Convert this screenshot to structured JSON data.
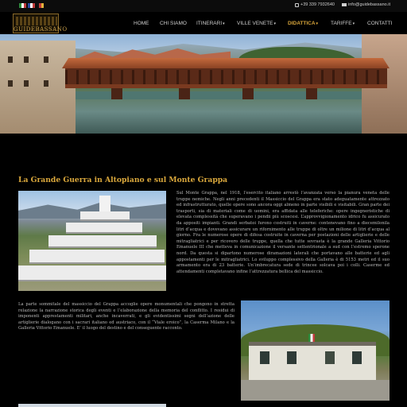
{
  "topbar": {
    "languages": [
      {
        "code": "it",
        "colors": [
          "#2a8a3a",
          "#ffffff",
          "#c23b3b"
        ]
      },
      {
        "code": "fr",
        "colors": [
          "#2b4aa0",
          "#ffffff",
          "#c23b3b"
        ]
      },
      {
        "code": "de",
        "colors": [
          "#111111",
          "#c23b3b",
          "#e2b23a"
        ]
      }
    ],
    "phone": "+39 339 7932640",
    "email": "info@guidebassano.it"
  },
  "header": {
    "logo_text": "GUIDEBASSANO",
    "nav": [
      {
        "label": "HOME",
        "has_dropdown": false,
        "active": false
      },
      {
        "label": "CHI SIAMO",
        "has_dropdown": false,
        "active": false
      },
      {
        "label": "ITINERARI",
        "has_dropdown": true,
        "active": false
      },
      {
        "label": "VILLE VENETE",
        "has_dropdown": true,
        "active": false
      },
      {
        "label": "DIDATTICA",
        "has_dropdown": true,
        "active": true
      },
      {
        "label": "TARIFFE",
        "has_dropdown": true,
        "active": false
      },
      {
        "label": "CONTATTI",
        "has_dropdown": false,
        "active": false
      }
    ],
    "chevron": "▾"
  },
  "colors": {
    "accent": "#d6a43a",
    "background": "#000000"
  },
  "content": {
    "title": "La Grande Guerra in Altopiano e sul Monte Grappa",
    "paragraph_1": "Sul Monte Grappa, nel 1918, l’esercito italiano arrestò l’avanzata verso la pianura veneta delle truppe nemiche. Negli anni precedenti il Massiccio del Grappa era stato adeguatamente attrezzato ed infrastrutturato, quelle opere sono ancora oggi almeno in parte visibili e visitabili. Gran parte dei trasporti, sia di materiali come di uomini, era affidata alle teleferiche: opere ingegneristiche di elevata complessità che superavano i pendii più scoscesi. L’approvvigionamento idrico fu assicurato da appositi impianti. Grandi serbatoi furono costruiti in caverne: contenevano fino a diecemilonila litri d’acqua e dovevano assicurare un rifornimento alle truppe di oltre un milione di litri d’acqua al giorno. Fra le numerose opere di difesa costruite in caverna per postazioni delle artiglierie e delle mitragliatrici e per ricovero delle truppe, quella che tutte sovrasta è la grande Galleria Vittorio Emanuele III che metteva in comunicazione il versante settentrionale a sud con l’estremo sperone nord. Da questa si dipartono numerose diramazioni laterali che portavano alle batterie ed agli appostamenti per le mitragliatrici. Lo sviluppo complessivo della Galleria è di 5153 metri ed il suo armamento era di 23 batterie. Un’imbrecatura sede di trincee solcava poi i colli. Caserme ed attendamenti completavano infine l’attrezzatura bellica del massiccio.",
    "paragraph_2": "La parte sommitale del massiccio del Grappa accoglie opere monumentali che pongono in stretta relazione la narrazione storica degli eventi e l’elaborazione della memoria del conflitto. I residui di imponenti apprestamenti militari, anche incaverrati, e gli evidentissimi segni dell’azione delle artiglierie dialogano con i sacrari italiano ed austriaco, con il “Viale eroico”, la Caserma Milano e la Galleria Vittorio Emanuele. E’ il luogo del destino e del conseguente racconto."
  }
}
